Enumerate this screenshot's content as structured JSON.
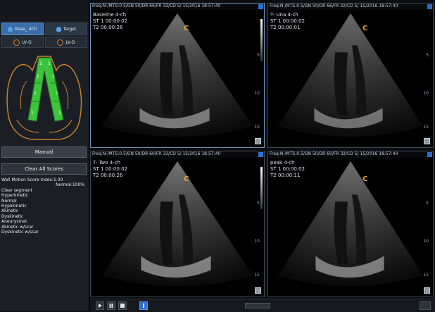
{
  "left_panel": {
    "title": "",
    "mode_buttons": [
      {
        "label": "Base_ 4Ch",
        "active": true
      },
      {
        "label": "Target",
        "active": false
      }
    ],
    "mode_buttons2": [
      {
        "label": "LV-G"
      },
      {
        "label": "LV-D"
      }
    ],
    "manual_label": "Manual",
    "clear_label": "Clear All Scores",
    "scores": [
      "Wall Motion Score Index:1.00",
      "Normal:100%",
      "Clear segment",
      "Hyperkinetic",
      "Normal",
      "Hypokinetic",
      "Akinetic",
      "Dyskinetic",
      "Aneurysmal",
      "Akinetic w/scar",
      "Dyskinetic w/scar"
    ]
  },
  "views": [
    {
      "header": "Freq:N-/MTS:0.5/GN 50/DR 66/FR 32/CD 5/ 15/2016 18:57:40",
      "line1": "Baseline 4-ch",
      "line2": "ST 1 00:00:02",
      "line3": "T2 00:00:26",
      "mark": "C",
      "ticks": [
        "5",
        "10",
        "15"
      ]
    },
    {
      "header": "Freq:N-/MTS:0.5/GN 50/DR 66/FR 32/CD 5/ 15/2016 18:57:40",
      "line1": "T- Una 4-ch",
      "line2": "ST 1 00:00:02",
      "line3": "T2 00:00:01",
      "mark": "C",
      "ticks": [
        "5",
        "10",
        "15"
      ]
    },
    {
      "header": "Freq:N-/MTS:0.5/GN 50/DR 60/FR 32/CD 5/ 15/2016 18:57:40",
      "line1": "T- Two 4-ch",
      "line2": "ST 1 00:00:02",
      "line3": "T2 00:00:26",
      "mark": "C",
      "ticks": [
        "5",
        "10",
        "15"
      ]
    },
    {
      "header": "Freq:N-/MTS:0.5/GN 50/DR 60/FR 32/CD 5/ 15/2016 18:57:40",
      "line1": "peak 4-ch",
      "line2": "ST 1 00:00:02",
      "line3": "T2 00:00:11",
      "mark": "C",
      "ticks": [
        "5",
        "10",
        "15"
      ]
    }
  ],
  "bottom_bar": {
    "play_icon": "play-icon",
    "pause_icon": "pause-icon",
    "stop_icon": "stop-icon"
  },
  "colors": {
    "segment_green": "#3cc43c",
    "heart_outline": "#c8822e",
    "accent_blue": "#2d6fd1",
    "mark_orange": "#e2a21f"
  }
}
